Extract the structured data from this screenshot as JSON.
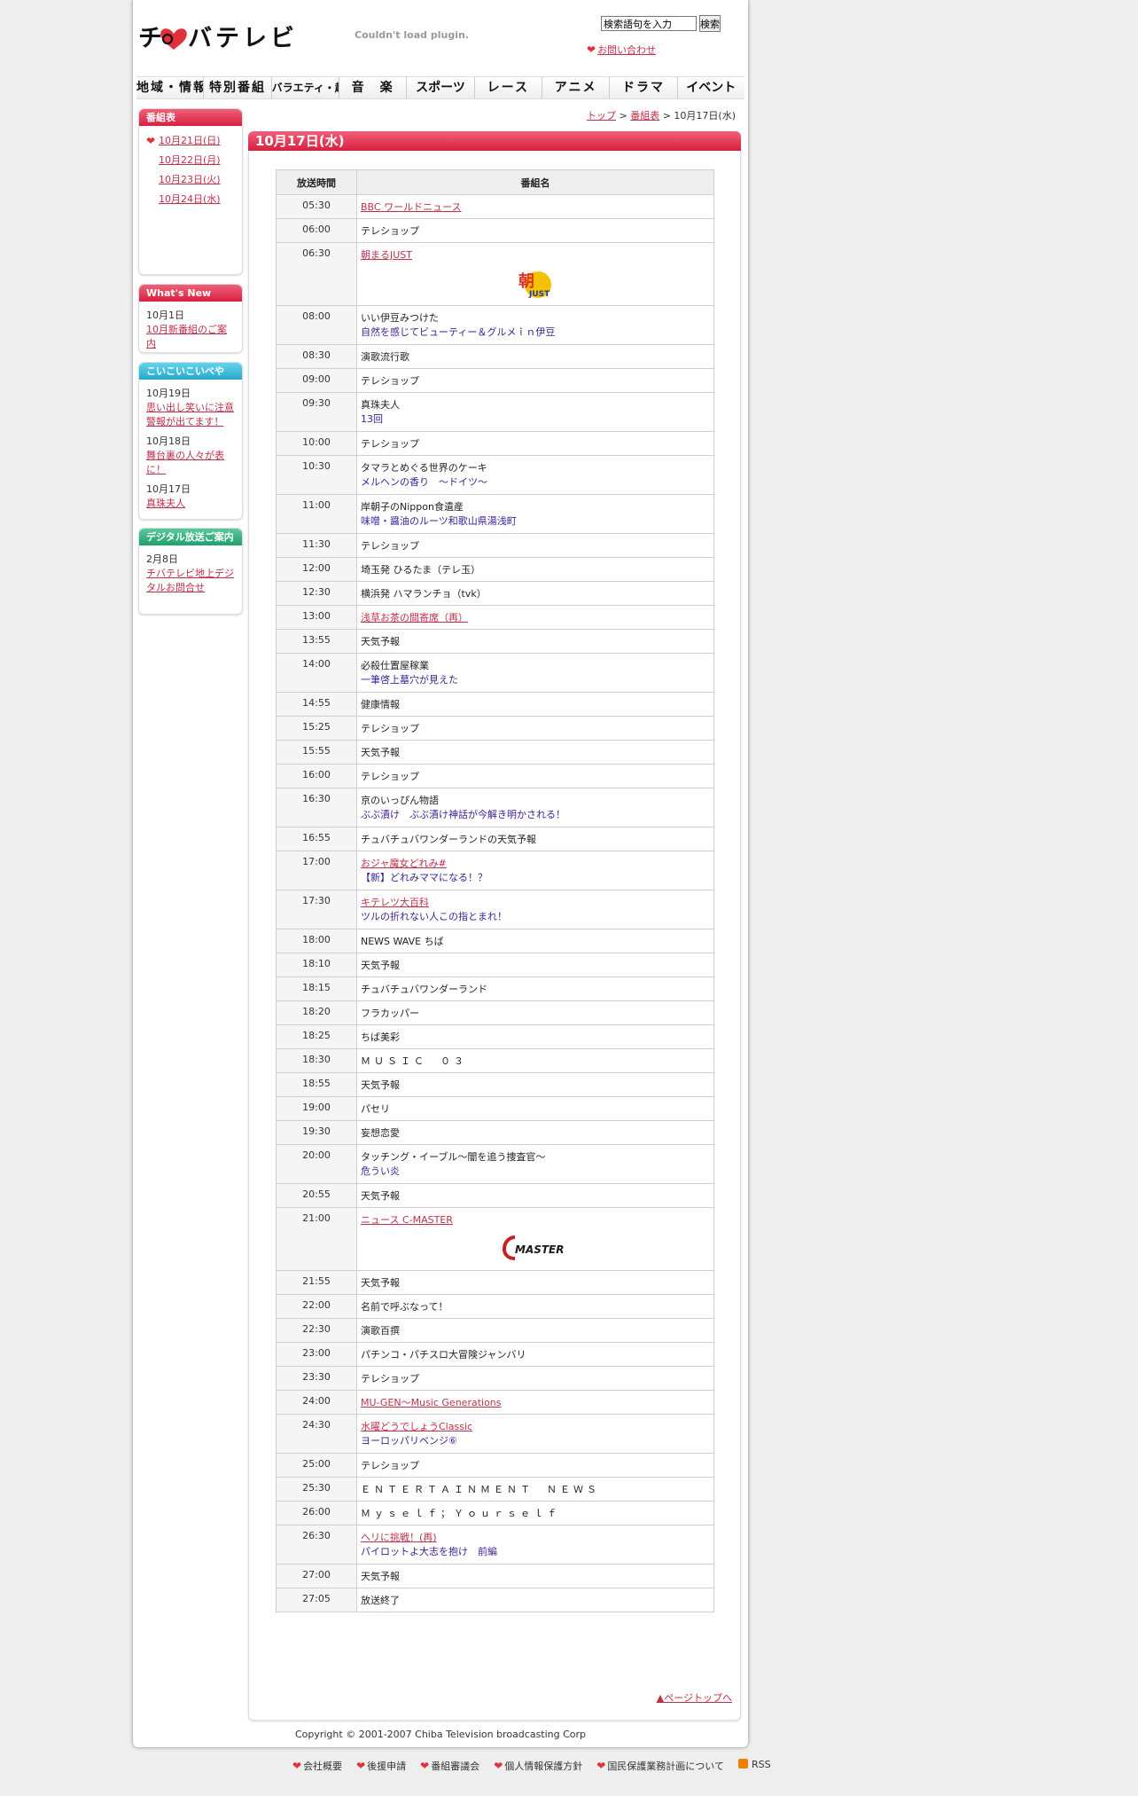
{
  "header": {
    "logo_text": "チバテレビ",
    "plugin_message": "Couldn't load plugin.",
    "search_value": "検索語句を入力",
    "search_button": "検索",
    "contact_label": "お問い合わせ"
  },
  "nav": [
    "地域・情報",
    "特別番組",
    "バラエティ・趣味",
    "音　楽",
    "スポーツ",
    "レース",
    "アニメ",
    "ドラマ",
    "イベント"
  ],
  "sidebar": {
    "schedule": {
      "title": "番組表",
      "dates": [
        "10月21日(日)",
        "10月22日(月)",
        "10月23日(火)",
        "10月24日(水)"
      ]
    },
    "whats_new": {
      "title": "What's New",
      "items": [
        {
          "date": "10月1日",
          "link": "10月新番組のご案内"
        }
      ]
    },
    "koikoi": {
      "title": "こいこいこいべや",
      "items": [
        {
          "date": "10月19日",
          "link": "思い出し笑いに注意警報が出てます！"
        },
        {
          "date": "10月18日",
          "link": "舞台裏の人々が表に！"
        },
        {
          "date": "10月17日",
          "link": "真珠夫人"
        }
      ]
    },
    "digital": {
      "title": "デジタル放送ご案内",
      "items": [
        {
          "date": "2月8日",
          "link": "チバテレビ地上デジタルお問合せ"
        }
      ]
    }
  },
  "breadcrumb": {
    "top": "トップ",
    "schedule": "番組表",
    "current": "10月17日(水)",
    "sep": ">"
  },
  "main": {
    "title": "10月17日(水)",
    "col_time": "放送時間",
    "col_program": "番組名",
    "rows": [
      {
        "time": "05:30",
        "title": "BBC ワールドニュース",
        "link": true
      },
      {
        "time": "06:00",
        "title": "テレショップ"
      },
      {
        "time": "06:30",
        "title": "朝まるJUST",
        "link": true,
        "logo": "asamaru"
      },
      {
        "time": "08:00",
        "title": "いい伊豆みつけた",
        "sub": "自然を感じてビューティー＆グルメｉｎ伊豆"
      },
      {
        "time": "08:30",
        "title": "演歌流行歌"
      },
      {
        "time": "09:00",
        "title": "テレショップ"
      },
      {
        "time": "09:30",
        "title": "真珠夫人",
        "sub": "13回"
      },
      {
        "time": "10:00",
        "title": "テレショップ"
      },
      {
        "time": "10:30",
        "title": "タマラとめぐる世界のケーキ",
        "sub": "メルヘンの香り　～ドイツ～"
      },
      {
        "time": "11:00",
        "title": "岸朝子のNippon食遺産",
        "sub": "味噌・醤油のルーツ和歌山県湯浅町"
      },
      {
        "time": "11:30",
        "title": "テレショップ"
      },
      {
        "time": "12:00",
        "title": "埼玉発 ひるたま（テレ玉）"
      },
      {
        "time": "12:30",
        "title": "横浜発 ハマランチョ（tvk）"
      },
      {
        "time": "13:00",
        "title": "浅草お茶の間寄席（再）",
        "link": true
      },
      {
        "time": "13:55",
        "title": "天気予報"
      },
      {
        "time": "14:00",
        "title": "必殺仕置屋稼業",
        "sub": "一筆啓上墓穴が見えた"
      },
      {
        "time": "14:55",
        "title": "健康情報"
      },
      {
        "time": "15:25",
        "title": "テレショップ"
      },
      {
        "time": "15:55",
        "title": "天気予報"
      },
      {
        "time": "16:00",
        "title": "テレショップ"
      },
      {
        "time": "16:30",
        "title": "京のいっぴん物語",
        "sub": "ぶぶ漬け　ぶぶ漬け神話が今解き明かされる！"
      },
      {
        "time": "16:55",
        "title": "チュバチュバワンダーランドの天気予報"
      },
      {
        "time": "17:00",
        "title": "おジャ魔女どれみ#",
        "link": true,
        "sub": "【新】どれみママになる！？"
      },
      {
        "time": "17:30",
        "title": "キテレツ大百科",
        "link": true,
        "sub": "ツルの折れない人この指とまれ！"
      },
      {
        "time": "18:00",
        "title": "NEWS WAVE ちば"
      },
      {
        "time": "18:10",
        "title": "天気予報"
      },
      {
        "time": "18:15",
        "title": "チュバチュバワンダーランド"
      },
      {
        "time": "18:20",
        "title": "フラカッパー"
      },
      {
        "time": "18:25",
        "title": "ちば美彩"
      },
      {
        "time": "18:30",
        "title": "ＭＵＳＩＣ　０３",
        "spaced": true
      },
      {
        "time": "18:55",
        "title": "天気予報"
      },
      {
        "time": "19:00",
        "title": "パセリ"
      },
      {
        "time": "19:30",
        "title": "妄想恋愛"
      },
      {
        "time": "20:00",
        "title": "タッチング・イーブル～闇を追う捜査官～",
        "sub": "危うい炎"
      },
      {
        "time": "20:55",
        "title": "天気予報"
      },
      {
        "time": "21:00",
        "title": "ニュース C-MASTER",
        "link": true,
        "logo": "cmaster"
      },
      {
        "time": "21:55",
        "title": "天気予報"
      },
      {
        "time": "22:00",
        "title": "名前で呼ぶなって！"
      },
      {
        "time": "22:30",
        "title": "演歌百撰"
      },
      {
        "time": "23:00",
        "title": "パチンコ・パチスロ大冒険ジャンバリ"
      },
      {
        "time": "23:30",
        "title": "テレショップ"
      },
      {
        "time": "24:00",
        "title": "MU-GEN～Music Generations",
        "link": true
      },
      {
        "time": "24:30",
        "title": "水曜どうでしょうClassic",
        "link": true,
        "sub": "ヨーロッパリベンジ⑥"
      },
      {
        "time": "25:00",
        "title": "テレショップ"
      },
      {
        "time": "25:30",
        "title": "ＥＮＴＥＲＴＡＩＮＭＥＮＴ　ＮＥＷＳ",
        "spaced": true
      },
      {
        "time": "26:00",
        "title": "Ｍｙｓｅｌｆ；Ｙｏｕｒｓｅｌｆ",
        "spaced": true
      },
      {
        "time": "26:30",
        "title": "ヘリに挑戦！(再)",
        "link": true,
        "sub": "パイロットよ大志を抱け　前編"
      },
      {
        "time": "27:00",
        "title": "天気予報"
      },
      {
        "time": "27:05",
        "title": "放送終了"
      }
    ]
  },
  "page_top": "▲ページトップへ",
  "copyright": "Copyright © 2001-2007 Chiba Television broadcasting Corp",
  "footer": [
    "会社概要",
    "後援申請",
    "番組審議会",
    "個人情報保護方針",
    "国民保護業務計画について",
    "RSS"
  ],
  "colors": {
    "accent": "#d8203e",
    "link": "#c0304a",
    "sub_text": "#3a1e98"
  }
}
